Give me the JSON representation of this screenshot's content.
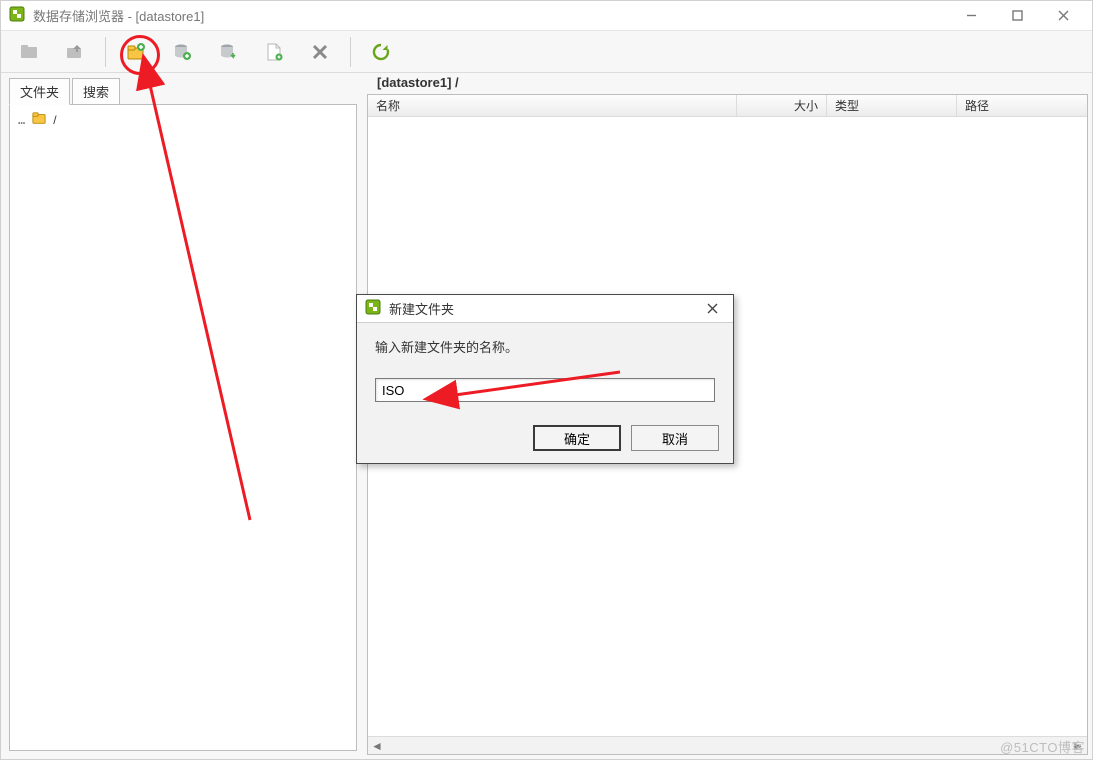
{
  "window": {
    "title": "数据存储浏览器 - [datastore1]"
  },
  "toolbar": {
    "icons": {
      "browse": "browse-icon",
      "up": "folder-up-icon",
      "new_folder": "new-folder-icon",
      "upload_db": "database-upload-icon",
      "download_db": "database-download-icon",
      "new_doc": "document-icon",
      "delete": "delete-icon",
      "refresh": "refresh-icon"
    }
  },
  "tabs": {
    "folders": "文件夹",
    "search": "搜索"
  },
  "tree": {
    "root_label": "/"
  },
  "right": {
    "path": "[datastore1] /",
    "columns": {
      "name": "名称",
      "size": "大小",
      "type": "类型",
      "path": "路径"
    },
    "rows": []
  },
  "dialog": {
    "title": "新建文件夹",
    "prompt": "输入新建文件夹的名称。",
    "value": "ISO",
    "ok": "确定",
    "cancel": "取消"
  },
  "watermark": "@51CTO博客"
}
